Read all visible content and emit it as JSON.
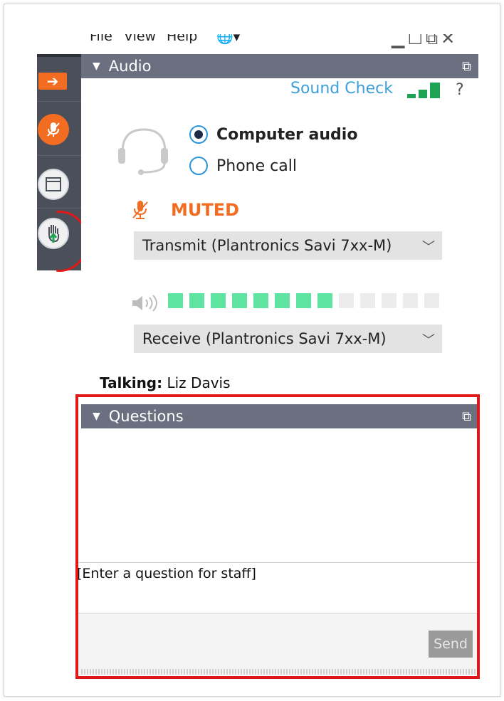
{
  "menu": {
    "file": "File",
    "view": "View",
    "help": "Help"
  },
  "audio_header": {
    "title": "Audio"
  },
  "sound_check": {
    "label": "Sound Check",
    "help": "?"
  },
  "audio_options": [
    {
      "label": "Computer audio",
      "selected": true
    },
    {
      "label": "Phone call",
      "selected": false
    }
  ],
  "mute_status": "MUTED",
  "transmit_device": "Transmit (Plantronics Savi 7xx-M)",
  "receive_device": "Receive (Plantronics Savi 7xx-M)",
  "volume_level": {
    "active": 8,
    "total": 13
  },
  "talking": {
    "label": "Talking:",
    "name": "Liz Davis"
  },
  "questions_header": {
    "title": "Questions"
  },
  "question_input": {
    "placeholder": "[Enter a question for staff]"
  },
  "send_button": "Send",
  "colors": {
    "accent_orange": "#f26d21",
    "header_gray": "#6a7080",
    "link_blue": "#3ea0d8",
    "meter_green": "#5ee3a1",
    "highlight_red": "#e01818"
  }
}
